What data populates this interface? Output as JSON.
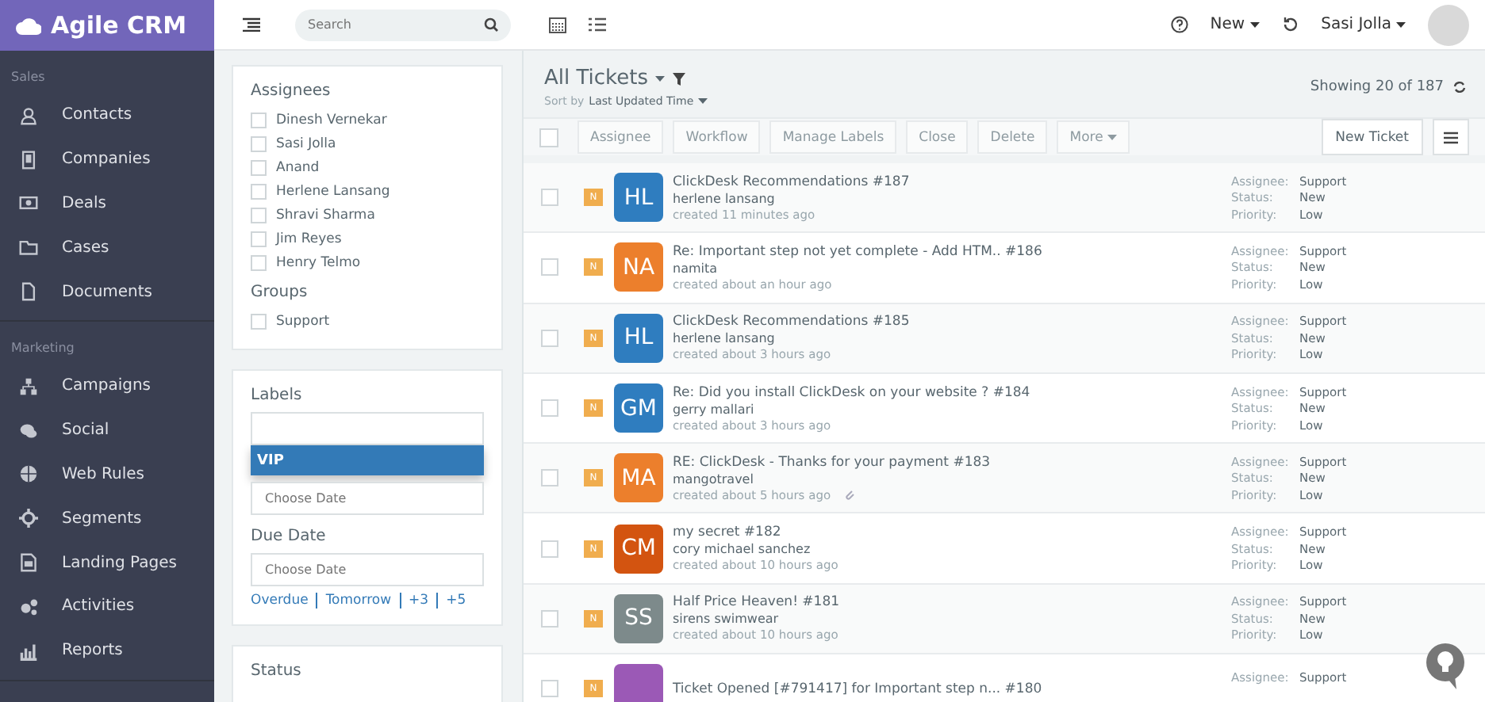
{
  "brand": "Agile CRM",
  "sidebar": {
    "sections": [
      {
        "title": "Sales",
        "items": [
          {
            "label": "Contacts"
          },
          {
            "label": "Companies"
          },
          {
            "label": "Deals"
          },
          {
            "label": "Cases"
          },
          {
            "label": "Documents"
          }
        ]
      },
      {
        "title": "Marketing",
        "items": [
          {
            "label": "Campaigns"
          },
          {
            "label": "Social"
          },
          {
            "label": "Web Rules"
          },
          {
            "label": "Segments"
          },
          {
            "label": "Landing Pages"
          },
          {
            "label": "Activities"
          },
          {
            "label": "Reports"
          }
        ]
      }
    ]
  },
  "topbar": {
    "search": {
      "placeholder": "Search"
    },
    "new_label": "New",
    "user": "Sasi Jolla"
  },
  "filters": {
    "assignees_title": "Assignees",
    "assignees": [
      {
        "label": "Dinesh Vernekar",
        "checked": false
      },
      {
        "label": "Sasi Jolla",
        "checked": false
      },
      {
        "label": "Anand",
        "checked": false
      },
      {
        "label": "Herlene Lansang",
        "checked": false
      },
      {
        "label": "Shravi Sharma",
        "checked": false
      },
      {
        "label": "Jim Reyes",
        "checked": false
      },
      {
        "label": "Henry Telmo",
        "checked": false
      }
    ],
    "groups_title": "Groups",
    "groups": [
      {
        "label": "Support",
        "checked": false
      }
    ],
    "labels": {
      "title": "Labels",
      "options": [
        {
          "label": "VIP",
          "selected": true
        }
      ],
      "date_placeholder": "Choose Date"
    },
    "due_date": {
      "title": "Due Date",
      "placeholder": "Choose Date",
      "links": [
        "Overdue",
        "Tomorrow",
        "+3",
        "+5"
      ]
    },
    "status_title": "Status"
  },
  "list": {
    "title": "All Tickets",
    "sort_prefix": "Sort by",
    "sort_value": "Last Updated Time",
    "showing": "Showing 20 of 187",
    "actions": [
      {
        "label": "Assignee",
        "kind": "plain"
      },
      {
        "label": "Workflow",
        "kind": "plain"
      },
      {
        "label": "Manage Labels",
        "kind": "plain"
      },
      {
        "label": "Close",
        "kind": "plain"
      },
      {
        "label": "Delete",
        "kind": "plain"
      },
      {
        "label": "More",
        "kind": "dropdown"
      }
    ],
    "new_ticket": "New Ticket",
    "select_all_checked": false,
    "tickets": [
      {
        "badge": "N",
        "initials": "HL",
        "color": "#2f7dbf",
        "checked": false,
        "subject": "ClickDesk Recommendations #187",
        "contact": "herlene lansang",
        "created": "created 11 minutes ago",
        "attachment": false,
        "meta": [
          {
            "label": "Assignee:",
            "value": "Support"
          },
          {
            "label": "Status:",
            "value": "New"
          },
          {
            "label": "Priority:",
            "value": "Low"
          }
        ]
      },
      {
        "badge": "N",
        "initials": "NA",
        "color": "#ec7f2c",
        "checked": false,
        "subject": "Re: Important step not yet complete - Add HTM.. #186",
        "contact": "namita",
        "created": "created about an hour ago",
        "attachment": false,
        "meta": [
          {
            "label": "Assignee:",
            "value": "Support"
          },
          {
            "label": "Status:",
            "value": "New"
          },
          {
            "label": "Priority:",
            "value": "Low"
          }
        ]
      },
      {
        "badge": "N",
        "initials": "HL",
        "color": "#2f7dbf",
        "checked": false,
        "subject": "ClickDesk Recommendations #185",
        "contact": "herlene lansang",
        "created": "created about 3 hours ago",
        "attachment": false,
        "meta": [
          {
            "label": "Assignee:",
            "value": "Support"
          },
          {
            "label": "Status:",
            "value": "New"
          },
          {
            "label": "Priority:",
            "value": "Low"
          }
        ]
      },
      {
        "badge": "N",
        "initials": "GM",
        "color": "#2f7dbf",
        "checked": false,
        "subject": "Re: Did you install ClickDesk on your website ? #184",
        "contact": "gerry mallari",
        "created": "created about 3 hours ago",
        "attachment": false,
        "meta": [
          {
            "label": "Assignee:",
            "value": "Support"
          },
          {
            "label": "Status:",
            "value": "New"
          },
          {
            "label": "Priority:",
            "value": "Low"
          }
        ]
      },
      {
        "badge": "N",
        "initials": "MA",
        "color": "#ec7f2c",
        "checked": false,
        "subject": "RE: ClickDesk - Thanks for your payment #183",
        "contact": "mangotravel",
        "created": "created about 5 hours ago",
        "attachment": true,
        "meta": [
          {
            "label": "Assignee:",
            "value": "Support"
          },
          {
            "label": "Status:",
            "value": "New"
          },
          {
            "label": "Priority:",
            "value": "Low"
          }
        ]
      },
      {
        "badge": "N",
        "initials": "CM",
        "color": "#d35410",
        "checked": false,
        "subject": "my secret #182",
        "contact": "cory michael sanchez",
        "created": "created about 10 hours ago",
        "attachment": false,
        "meta": [
          {
            "label": "Assignee:",
            "value": "Support"
          },
          {
            "label": "Status:",
            "value": "New"
          },
          {
            "label": "Priority:",
            "value": "Low"
          }
        ]
      },
      {
        "badge": "N",
        "initials": "SS",
        "color": "#7d8a8b",
        "checked": false,
        "subject": "Half Price Heaven!  #181",
        "contact": "sirens swimwear",
        "created": "created about 10 hours ago",
        "attachment": false,
        "meta": [
          {
            "label": "Assignee:",
            "value": "Support"
          },
          {
            "label": "Status:",
            "value": "New"
          },
          {
            "label": "Priority:",
            "value": "Low"
          }
        ]
      },
      {
        "badge": "N",
        "color": "#9b59b6",
        "checked": false,
        "subject": "Ticket Opened [#791417] for Important step n...  #180",
        "meta": [
          {
            "label": "Assignee:",
            "value": "Support"
          }
        ]
      }
    ]
  }
}
